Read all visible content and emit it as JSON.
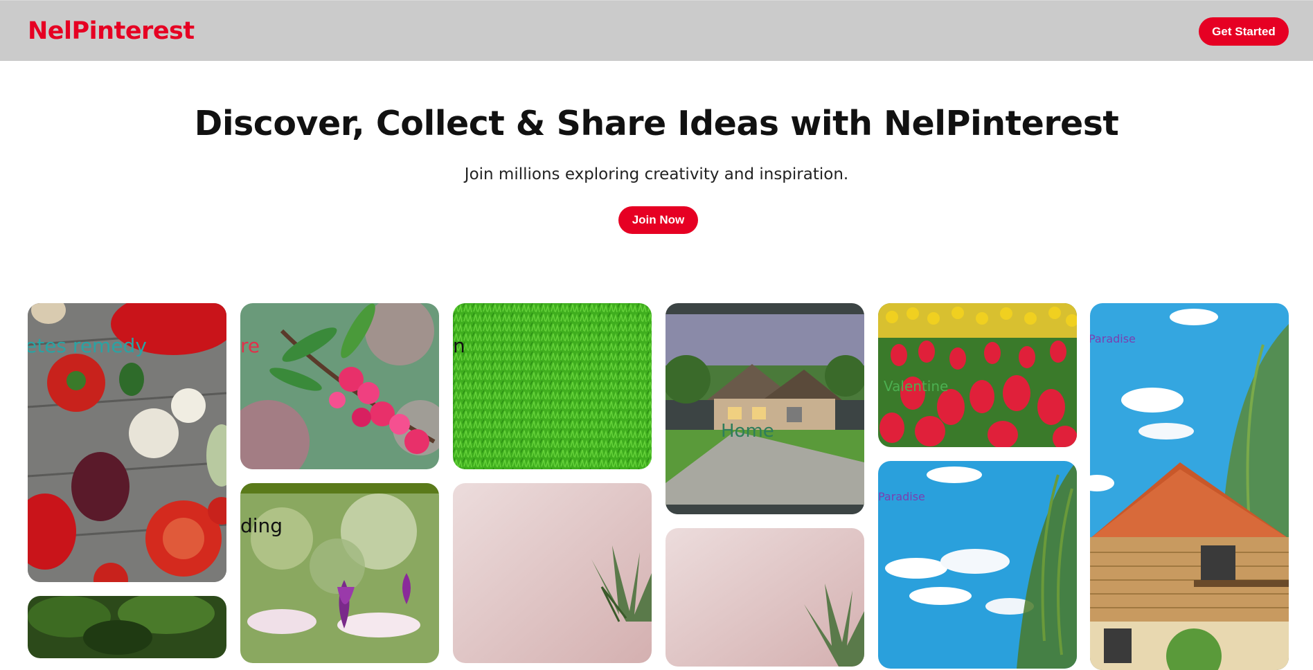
{
  "header": {
    "logo": "NelPinterest",
    "cta_label": "Get Started"
  },
  "hero": {
    "title": "Discover, Collect & Share Ideas with NelPinterest",
    "subtitle": "Join millions exploring creativity and inspiration.",
    "cta_label": "Join Now"
  },
  "pins": [
    {
      "label": "etes remedy",
      "label_color": "#2aa3a3",
      "image": "vegetables-tomatoes-garlic-peppers"
    },
    {
      "label": "re",
      "label_color": "#e0314b",
      "image": "pink-blossom-branch"
    },
    {
      "label": "n",
      "label_color": "#111111",
      "image": "green-grass"
    },
    {
      "label": "Home",
      "label_color": "#2e7d5b",
      "image": "stone-house-lawn"
    },
    {
      "label": "Valentine",
      "label_color": "#4caf50",
      "image": "red-yellow-tulips"
    },
    {
      "label": "Paradise",
      "label_color": "#7a3fb0",
      "image": "wooden-house-willow-sky"
    },
    {
      "label": "",
      "label_color": "",
      "image": "palm-trees"
    },
    {
      "label": "ding",
      "label_color": "#111111",
      "image": "purple-tulips-garden"
    },
    {
      "label": "",
      "label_color": "",
      "image": "pineapple-pink-background"
    },
    {
      "label": "",
      "label_color": "",
      "image": "pineapple-pink-background"
    },
    {
      "label": "Paradise",
      "label_color": "#7a3fb0",
      "image": "willow-sky-clouds"
    }
  ],
  "colors": {
    "brand_red": "#e60023",
    "header_bg": "#cbcbcb"
  }
}
